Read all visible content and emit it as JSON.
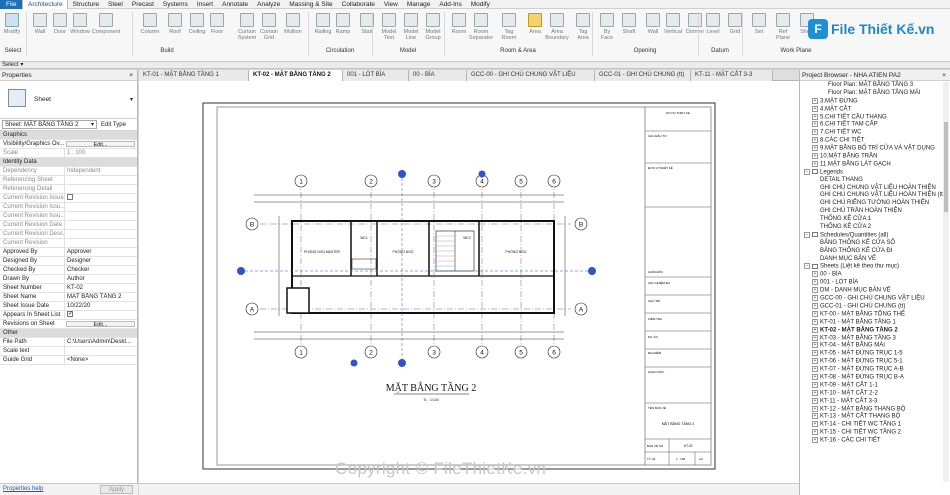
{
  "menu": {
    "tabs": [
      "File",
      "Architecture",
      "Structure",
      "Steel",
      "Precast",
      "Systems",
      "Insert",
      "Annotate",
      "Analyze",
      "Massing & Site",
      "Collaborate",
      "View",
      "Manage",
      "Add-Ins",
      "Modify"
    ],
    "active": "Architecture"
  },
  "ribbon": {
    "buttons": [
      "Modify",
      "Wall",
      "Door",
      "Window",
      "Component",
      "Column",
      "Roof",
      "Ceiling",
      "Floor",
      "Curtain\nSystem",
      "Curtain\nGrid",
      "Mullion",
      "Railing",
      "Ramp",
      "Stair",
      "Model\nText",
      "Model\nLine",
      "Model\nGroup",
      "Room",
      "Room\nSeparator",
      "Tag\nRoom",
      "Area",
      "Area\nBoundary",
      "Tag\nArea",
      "By\nFace",
      "Shaft",
      "Wall",
      "Vertical",
      "Dormer",
      "Level",
      "Grid",
      "Set",
      "Ref\nPlane",
      "Show"
    ],
    "groups": [
      "Select",
      "Build",
      "Circulation",
      "Model",
      "Room & Area",
      "Opening",
      "Datum",
      "Work Plane"
    ],
    "select_label": "Select ▾"
  },
  "logo": {
    "text": "File Thiết Kế.vn"
  },
  "watermark": "Copyright © FileThietKe.vn",
  "properties": {
    "title": "Properties",
    "type_name": "Sheet",
    "selector": "Sheet: MẶT BẰNG TẦNG 2",
    "edit_type": "Edit Type",
    "rows": [
      {
        "k": "Graphics",
        "sec": true
      },
      {
        "k": "Visibility/Graphics Ov...",
        "btn": "Edit..."
      },
      {
        "k": "Scale",
        "v": "1 : 100",
        "dim": true
      },
      {
        "k": "Identity Data",
        "sec": true
      },
      {
        "k": "Dependency",
        "v": "Independent",
        "dim": true
      },
      {
        "k": "Referencing Sheet",
        "v": "",
        "dim": true
      },
      {
        "k": "Referencing Detail",
        "v": "",
        "dim": true
      },
      {
        "k": "Current Revision Issued",
        "chk": "off",
        "dim": true
      },
      {
        "k": "Current Revision Issu...",
        "v": "",
        "dim": true
      },
      {
        "k": "Current Revision Issu...",
        "v": "",
        "dim": true
      },
      {
        "k": "Current Revision Date",
        "v": "",
        "dim": true
      },
      {
        "k": "Current Revision Desc...",
        "v": "",
        "dim": true
      },
      {
        "k": "Current Revision",
        "v": "",
        "dim": true
      },
      {
        "k": "Approved By",
        "v": "Approver"
      },
      {
        "k": "Designed By",
        "v": "Designer"
      },
      {
        "k": "Checked By",
        "v": "Checker"
      },
      {
        "k": "Drawn By",
        "v": "Author"
      },
      {
        "k": "Sheet Number",
        "v": "KT-02"
      },
      {
        "k": "Sheet Name",
        "v": "MẶT BẰNG TẦNG 2"
      },
      {
        "k": "Sheet Issue Date",
        "v": "10/22/20"
      },
      {
        "k": "Appears In Sheet List",
        "chk": "on"
      },
      {
        "k": "Revisions on Sheet",
        "btn": "Edit..."
      },
      {
        "k": "Other",
        "sec": true
      },
      {
        "k": "File Path",
        "v": "C:\\Users\\Admin\\Deskt..."
      },
      {
        "k": "Scale text",
        "v": ""
      },
      {
        "k": "Guide Grid",
        "v": "<None>"
      }
    ],
    "help": "Properties help",
    "apply": "Apply"
  },
  "view_tabs": [
    {
      "label": "KT-01 - MẶT BẰNG TẦNG 1",
      "active": false
    },
    {
      "label": "KT-02 - MẶT BẰNG TẦNG 2",
      "active": true
    },
    {
      "label": "001 - LÓT BÌA",
      "active": false
    },
    {
      "label": "00 - BÌA",
      "active": false
    },
    {
      "label": "GCC-00 - GHI CHÚ CHUNG VẬT LIỆU",
      "active": false
    },
    {
      "label": "GCC-01 - GHI CHÚ CHUNG (tt)",
      "active": false
    },
    {
      "label": "KT-11 - MẶT CẮT 3-3",
      "active": false
    }
  ],
  "drawing": {
    "title": "MẶT BẰNG TẦNG 2",
    "scale": "TL : 1/100",
    "grids_top": [
      "1",
      "2",
      "3",
      "4",
      "5",
      "6"
    ],
    "grids_side": [
      "A",
      "B"
    ],
    "rooms": [
      "PHÒNG NGỦ MASTER",
      "PHÒNG NGỦ",
      "WC1",
      "WC2",
      "PHÒNG NGỦ"
    ],
    "titleblock": {
      "company": "DO NV THIET KE",
      "chu_dau_tu": "CHỦ ĐẦU TƯ",
      "don_vi": "ĐƠN VỊ THIẾT KẾ",
      "rows": [
        "GIÁM ĐỐC",
        "CHỦ NHIỆM ĐA",
        "CHỦ TRÌ",
        "KIỂM TRA",
        "DỰ ÁN",
        "ĐỊA ĐIỂM",
        "HẠNG MỤC",
        "TÊN BẢN VẼ"
      ],
      "sheet_name": "MẶT BẰNG TẦNG 2",
      "ban_ve_so_label": "BẢN VẼ SỐ",
      "ban_ve_so": "KT-02",
      "ty_le_label": "TỶ LỆ",
      "ty_le": "1 : 100",
      "size": "A3"
    }
  },
  "browser": {
    "title": "Project Browser - NHA ATIEN PA2",
    "items": [
      {
        "t": "Floor Plan: MẶT BẰNG TẦNG 3",
        "d": 3
      },
      {
        "t": "Floor Plan: MẶT BẰNG TẦNG MÁI",
        "d": 3
      },
      {
        "t": "3.MẶT ĐỨNG",
        "d": 1,
        "tg": "+"
      },
      {
        "t": "4.MẶT CẮT",
        "d": 1,
        "tg": "+"
      },
      {
        "t": "5.CHI TIẾT CẦU THANG",
        "d": 1,
        "tg": "+"
      },
      {
        "t": "6.CHI TIẾT TAM CẤP",
        "d": 1,
        "tg": "+"
      },
      {
        "t": "7.CHI TIẾT WC",
        "d": 1,
        "tg": "+"
      },
      {
        "t": "8.CÁC CHI TIẾT",
        "d": 1,
        "tg": "+"
      },
      {
        "t": "9.MẶT BẰNG BỐ TRÍ CỬA VÀ VẬT DỤNG",
        "d": 1,
        "tg": "+"
      },
      {
        "t": "10.MẶT BẰNG TRẦN",
        "d": 1,
        "tg": "+"
      },
      {
        "t": "11.MẶT BẰNG LÁT GẠCH",
        "d": 1,
        "tg": "+"
      },
      {
        "t": "Legends",
        "d": 0,
        "tg": "-",
        "icon": true
      },
      {
        "t": "DETAIL THANG",
        "d": 2
      },
      {
        "t": "GHI CHÚ CHUNG VẬT LIỆU HOÀN THIỆN",
        "d": 2
      },
      {
        "t": "GHI CHÚ CHUNG VẬT LIỆU HOÀN THIỆN (tt)",
        "d": 2
      },
      {
        "t": "GHI CHÚ RIÊNG TƯỜNG HOÀN THIỆN",
        "d": 2
      },
      {
        "t": "GHI CHÚ TRẦN HOÀN THIỆN",
        "d": 2
      },
      {
        "t": "THỐNG KÊ CỬA 1",
        "d": 2
      },
      {
        "t": "THỐNG KÊ CỬA 2",
        "d": 2
      },
      {
        "t": "Schedules/Quantities (all)",
        "d": 0,
        "tg": "-",
        "icon": true
      },
      {
        "t": "BẢNG THỐNG KÊ CỬA SỔ",
        "d": 2
      },
      {
        "t": "BẢNG THỐNG KÊ CỬA ĐI",
        "d": 2
      },
      {
        "t": "DANH MỤC BẢN VẼ",
        "d": 2
      },
      {
        "t": "Sheets (Liệt kê theo thư mục)",
        "d": 0,
        "tg": "-",
        "icon": true
      },
      {
        "t": "00 - BÌA",
        "d": 1,
        "tg": "+"
      },
      {
        "t": "001 - LÓT BÌA",
        "d": 1,
        "tg": "+"
      },
      {
        "t": "DM - DANH MỤC BẢN VẼ",
        "d": 1,
        "tg": "+"
      },
      {
        "t": "GCC-00 - GHI CHÚ CHUNG VẬT LIỆU",
        "d": 1,
        "tg": "+"
      },
      {
        "t": "GCC-01 - GHI CHÚ CHUNG (tt)",
        "d": 1,
        "tg": "+"
      },
      {
        "t": "KT-00 - MẶT BẰNG TỔNG THỂ",
        "d": 1,
        "tg": "+"
      },
      {
        "t": "KT-01 - MẶT BẰNG TẦNG 1",
        "d": 1,
        "tg": "+"
      },
      {
        "t": "KT-02 - MẶT BẰNG TẦNG 2",
        "d": 1,
        "tg": "+",
        "b": true
      },
      {
        "t": "KT-03 - MẶT BẰNG TẦNG 3",
        "d": 1,
        "tg": "+"
      },
      {
        "t": "KT-04 - MẶT BẰNG MÁI",
        "d": 1,
        "tg": "+"
      },
      {
        "t": "KT-05 - MẶT ĐỨNG TRỤC 1-5",
        "d": 1,
        "tg": "+"
      },
      {
        "t": "KT-06 - MẶT ĐỨNG TRỤC 5-1",
        "d": 1,
        "tg": "+"
      },
      {
        "t": "KT-07 - MẶT ĐỨNG TRỤC A-B",
        "d": 1,
        "tg": "+"
      },
      {
        "t": "KT-08 - MẶT ĐỨNG TRỤC B-A",
        "d": 1,
        "tg": "+"
      },
      {
        "t": "KT-09 - MẶT CẮT 1-1",
        "d": 1,
        "tg": "+"
      },
      {
        "t": "KT-10 - MẶT CẮT 2-2",
        "d": 1,
        "tg": "+"
      },
      {
        "t": "KT-11 - MẶT CẮT 3-3",
        "d": 1,
        "tg": "+"
      },
      {
        "t": "KT-12 - MẶT BẰNG THANG BỘ",
        "d": 1,
        "tg": "+"
      },
      {
        "t": "KT-13 - MẶT CẮT THANG BỘ",
        "d": 1,
        "tg": "+"
      },
      {
        "t": "KT-14 - CHI TIẾT WC TẦNG 1",
        "d": 1,
        "tg": "+"
      },
      {
        "t": "KT-15 - CHI TIẾT WC TẦNG 2",
        "d": 1,
        "tg": "+"
      },
      {
        "t": "KT-16 - CÁC CHI TIẾT",
        "d": 1,
        "tg": "+"
      }
    ]
  }
}
